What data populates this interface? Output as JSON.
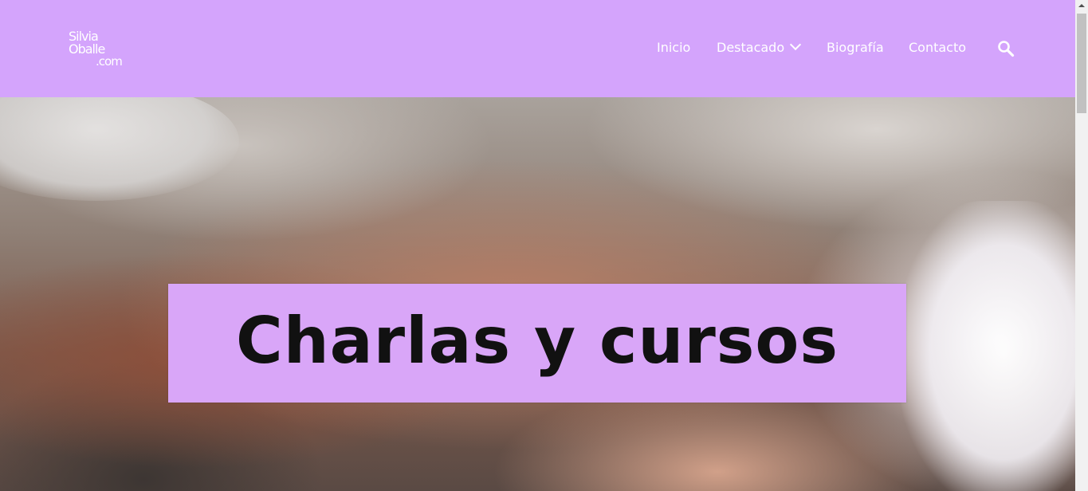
{
  "header": {
    "logo": {
      "line1": "Silvia",
      "line2": "Oballe",
      "line3": ".com"
    },
    "nav": [
      {
        "label": "Inicio"
      },
      {
        "label": "Destacado",
        "has_dropdown": true,
        "icon": "chevron-down-icon"
      },
      {
        "label": "Biografía"
      },
      {
        "label": "Contacto"
      }
    ],
    "search_icon": "search-icon",
    "background_color": "#d4a4fc"
  },
  "hero": {
    "banner_text": "Charlas y cursos",
    "banner_color": "#d9a6f8"
  }
}
